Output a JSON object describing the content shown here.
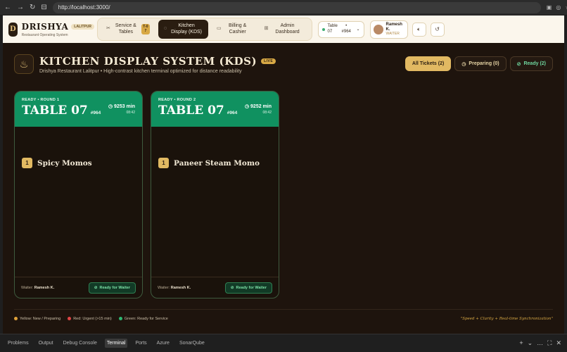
{
  "browser": {
    "url": "http://localhost:3000/",
    "back": "←",
    "forward": "→",
    "refresh": "↻",
    "nav_extra": "⊟"
  },
  "header": {
    "logo_letter": "D",
    "brand": "DRISHYA",
    "location_badge": "LALITPUR",
    "subtitle": "Restaurant Operating System",
    "nav": [
      {
        "label": "Service & Tables",
        "badge": "T-07",
        "icon": "✂"
      },
      {
        "label": "Kitchen Display (KDS)",
        "icon": "◌"
      },
      {
        "label": "Billing & Cashier",
        "icon": "▭"
      },
      {
        "label": "Admin Dashboard",
        "icon": "⊞"
      }
    ],
    "table_select": {
      "table": "Table 07",
      "order": "#964",
      "bullet": "•"
    },
    "user": {
      "name": "Ramesh K.",
      "role": "WAITER"
    }
  },
  "kds": {
    "title": "KITCHEN DISPLAY SYSTEM (KDS)",
    "live_badge": "LIVE",
    "subtitle": "Drishya Restaurant Lalitpur • High-contrast kitchen terminal optimized for distance readability",
    "filters": [
      {
        "label": "All Tickets (2)"
      },
      {
        "label": "Preparing (0)"
      },
      {
        "label": "Ready (2)"
      }
    ],
    "tickets": [
      {
        "status": "READY • ROUND 1",
        "table": "TABLE 07",
        "order": "#964",
        "minutes": "9253 min",
        "clock": "08:42",
        "qty": "1",
        "item": "Spicy Momos",
        "waiter_label": "Waiter:",
        "waiter": "Ramesh K.",
        "action": "Ready for Waiter"
      },
      {
        "status": "READY • ROUND 2",
        "table": "TABLE 07",
        "order": "#964",
        "minutes": "9252 min",
        "clock": "08:42",
        "qty": "1",
        "item": "Paneer Steam Momo",
        "waiter_label": "Waiter:",
        "waiter": "Ramesh K.",
        "action": "Ready for Waiter"
      }
    ],
    "legend": [
      {
        "label": "Yellow: New / Preparing",
        "color": "#e0a23a"
      },
      {
        "label": "Red: Urgent (>15 min)",
        "color": "#e04545"
      },
      {
        "label": "Green: Ready for Service",
        "color": "#2eb872"
      }
    ],
    "tagline": "\"Speed + Clarity + Real-time Synchronization\""
  },
  "panel": {
    "tabs": [
      "Problems",
      "Output",
      "Debug Console",
      "Terminal",
      "Ports",
      "Azure",
      "SonarQube"
    ],
    "active_tab": "Terminal"
  }
}
